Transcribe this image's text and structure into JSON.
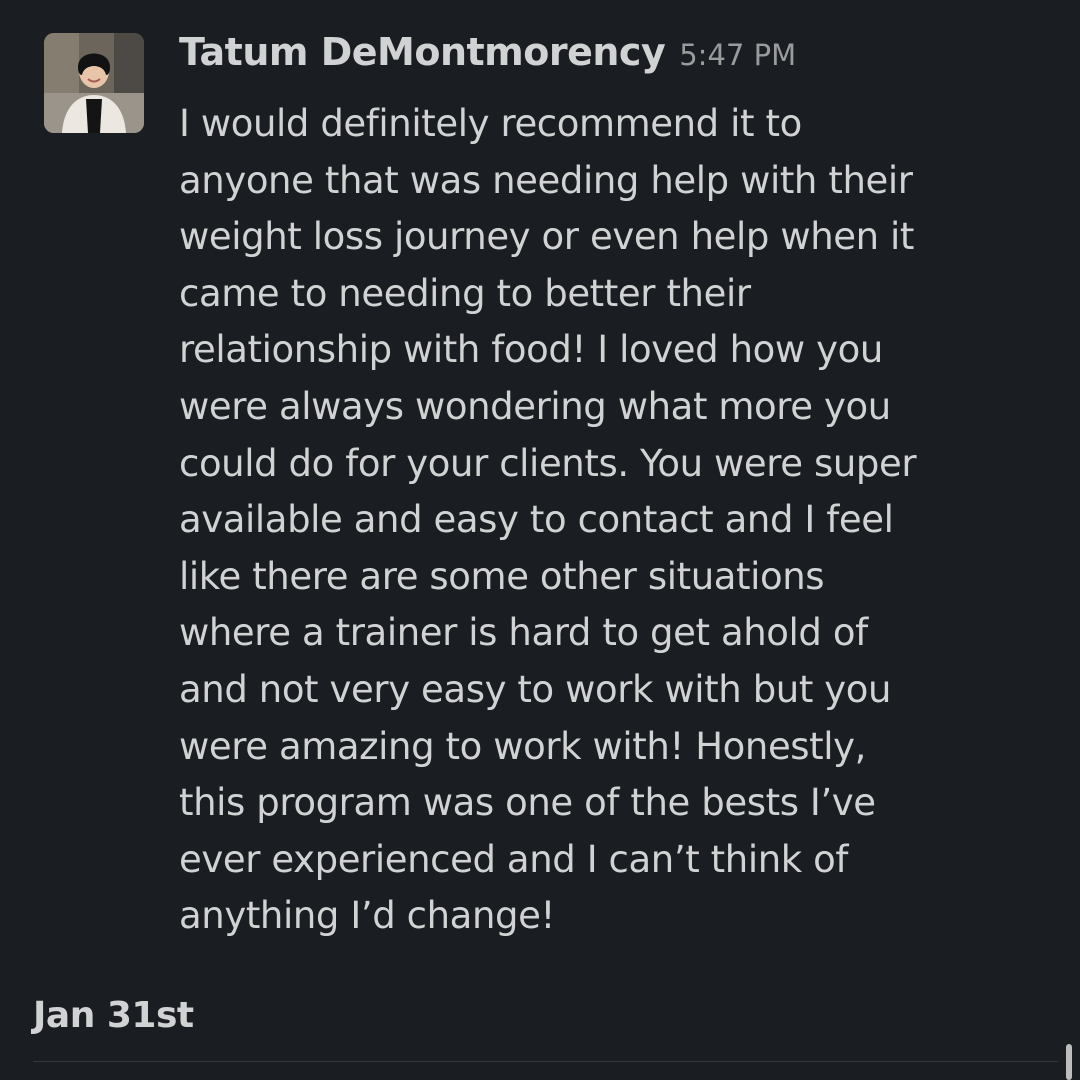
{
  "message": {
    "sender": "Tatum DeMontmorency",
    "timestamp": "5:47 PM",
    "lines": [
      "I would definitely recommend it to",
      "anyone that was needing help with their",
      "weight loss journey or even help when it",
      "came to needing to better their",
      "relationship with food! I loved how you",
      "were always wondering what more you",
      "could do for your clients. You were super",
      "available and easy to contact and I feel",
      "like there are some other situations",
      "where a trainer is hard to get ahold of",
      "and not very easy to work with but you",
      "were amazing to work with! Honestly,",
      "this program was one of the bests I’ve",
      "ever experienced and I can’t think of",
      "anything I’d change!"
    ]
  },
  "divider": {
    "date": "Jan 31st"
  },
  "colors": {
    "background": "#1a1d21",
    "text": "#d1d2d3",
    "timestamp": "#9a9b9d"
  }
}
